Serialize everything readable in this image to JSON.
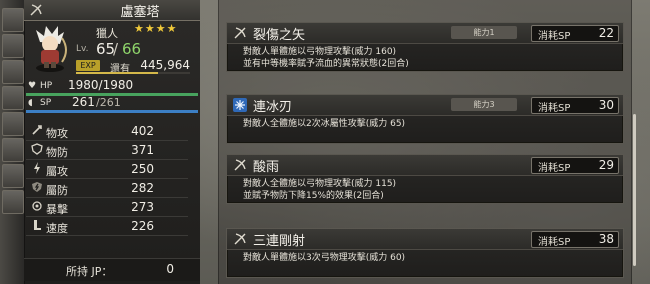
{
  "character": {
    "name": "盧塞塔",
    "job": "獵人",
    "stars": "★★★★",
    "level": {
      "label": "Lv.",
      "current": "65",
      "separator": "/",
      "max": "66"
    },
    "exp": {
      "badge": "EXP",
      "label": "還有",
      "value": "445,964",
      "progress": 0.72
    },
    "hp": {
      "label": "HP",
      "text": "1980/1980",
      "fill": 1.0,
      "color": "#48a35e"
    },
    "sp": {
      "label": "SP",
      "current": "261",
      "max": "/261",
      "fill": 1.0,
      "color": "#3c7fc4"
    },
    "stats": [
      {
        "label": "物攻",
        "value": "402",
        "icon": "physical-attack-icon"
      },
      {
        "label": "物防",
        "value": "371",
        "icon": "physical-defense-icon"
      },
      {
        "label": "屬攻",
        "value": "250",
        "icon": "elemental-attack-icon"
      },
      {
        "label": "屬防",
        "value": "282",
        "icon": "elemental-defense-icon"
      },
      {
        "label": "暴擊",
        "value": "273",
        "icon": "critical-icon"
      },
      {
        "label": "速度",
        "value": "226",
        "icon": "speed-icon"
      }
    ],
    "jp": {
      "label": "所持 JP：",
      "value": "0"
    }
  },
  "skills": [
    {
      "name": "裂傷之矢",
      "tag": "能力1",
      "cost_label": "消耗SP",
      "cost": "22",
      "icon": "bow-icon",
      "desc1": "對敵人單體施以弓物理攻擊(威力 160)",
      "desc2": "並有中等機率賦予流血的異常狀態(2回合)"
    },
    {
      "name": "連冰刃",
      "tag": "能力3",
      "cost_label": "消耗SP",
      "cost": "30",
      "icon": "ice-icon",
      "desc1": "對敵人全體施以2次冰屬性攻擊(威力 65)",
      "desc2": ""
    },
    {
      "name": "酸雨",
      "tag": "",
      "cost_label": "消耗SP",
      "cost": "29",
      "icon": "bow-icon",
      "desc1": "對敵人全體施以弓物理攻擊(威力 115)",
      "desc2": "並賦予物防下降15%的效果(2回合)"
    },
    {
      "name": "三連剛射",
      "tag": "",
      "cost_label": "消耗SP",
      "cost": "38",
      "icon": "bow-icon",
      "desc1": "對敵人單體施以3次弓物理攻擊(威力 60)",
      "desc2": ""
    }
  ],
  "colors": {
    "star": "#f0c93a",
    "lv_max": "#8fd56b",
    "exp_badge": "#b9a02a"
  }
}
